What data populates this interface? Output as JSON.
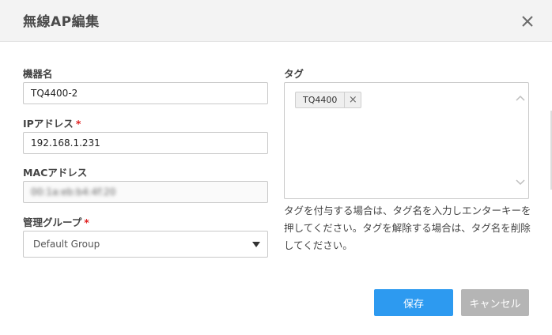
{
  "dialog": {
    "title": "無線AP編集",
    "close_icon": "close-icon"
  },
  "form": {
    "device_name": {
      "label": "機器名",
      "value": "TQ4400-2"
    },
    "ip_address": {
      "label": "IPアドレス",
      "required_mark": "*",
      "value": "192.168.1.231"
    },
    "mac_address": {
      "label": "MACアドレス",
      "value": "00:1a:eb:b4:4f:20"
    },
    "management_group": {
      "label": "管理グループ",
      "required_mark": "*",
      "selected": "Default Group"
    }
  },
  "tags": {
    "label": "タグ",
    "items": [
      {
        "text": "TQ4400",
        "remove_glyph": "×"
      }
    ],
    "help_text": "タグを付与する場合は、タグ名を入力しエンターキーを押してください。タグを解除する場合は、タグ名を削除してください。"
  },
  "buttons": {
    "save": "保存",
    "cancel": "キャンセル"
  },
  "colors": {
    "primary": "#2d9af0",
    "disabled": "#b5b5b5",
    "required": "#e02020",
    "header_bg": "#f3f3f3"
  }
}
